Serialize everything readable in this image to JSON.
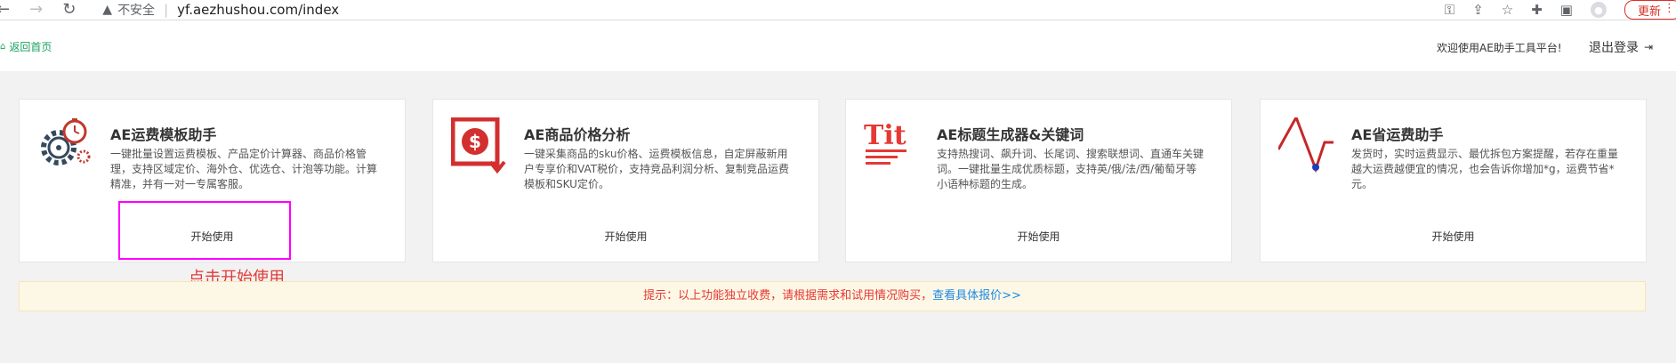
{
  "browser": {
    "security": "不安全",
    "url": "yf.aezhushou.com/index",
    "update_label": "更新"
  },
  "header": {
    "home_link": "返回首页",
    "welcome": "欢迎使用AE助手工具平台!",
    "logout": "退出登录"
  },
  "cards": [
    {
      "title": "AE运费模板助手",
      "desc": "一键批量设置运费模板、产品定价计算器、商品价格管理，支持区域定价、海外仓、优选仓、计泡等功能。计算精准，并有一对一专属客服。",
      "button": "开始使用",
      "icon": "gear-timer-icon",
      "color": "#34495e"
    },
    {
      "title": "AE商品价格分析",
      "desc": "一键采集商品的sku价格、运费模板信息，自定屏蔽新用户专享价和VAT税价，支持竞品利润分析、复制竞品运费模板和SKU定价。",
      "button": "开始使用",
      "icon": "dollar-download-icon",
      "color": "#d32f2f"
    },
    {
      "title": "AE标题生成器&关键词",
      "desc": "支持热搜词、飙升词、长尾词、搜索联想词、直通车关键词。一键批量生成优质标题，支持英/俄/法/西/葡萄牙等小语种标题的生成。",
      "button": "开始使用",
      "icon": "tit-text-icon",
      "color": "#e53935"
    },
    {
      "title": "AE省运费助手",
      "desc": "发货时，实时运费显示、最优拆包方案提醒，若存在重量越大运费越便宜的情况，也会告诉你增加*g，运费节省*元。",
      "button": "开始使用",
      "icon": "trend-line-icon",
      "color": "#c62828"
    }
  ],
  "annotation": "点击开始使用",
  "notice": {
    "text": "提示：以上功能独立收费，请根据需求和试用情况购买，",
    "link": "查看具体报价>>"
  },
  "colors": {
    "accent_green": "#1aa260",
    "highlight": "#ff00ff",
    "notice_text": "#e53935",
    "notice_link": "#1e88e5"
  }
}
